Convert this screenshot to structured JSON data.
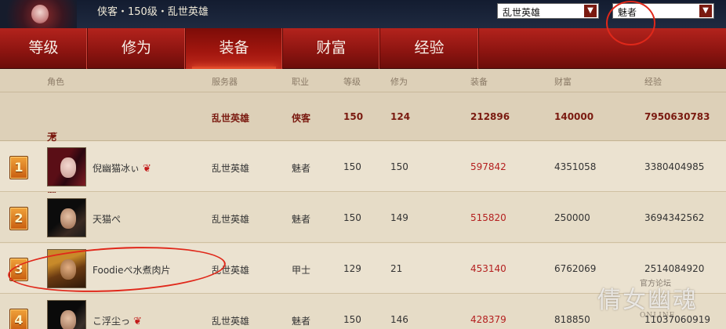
{
  "top_bar": {
    "character_info": "侠客・150级・乱世英雄",
    "server_select": "乱世英雄",
    "class_select": "魅者"
  },
  "tabs": [
    "等级",
    "修为",
    "装备",
    "财富",
    "经验"
  ],
  "active_tab": "装备",
  "columns": [
    "角色",
    "服务器",
    "职业",
    "等级",
    "修为",
    "装备",
    "财富",
    "经验"
  ],
  "my_row": {
    "name": "无敌最俊郎",
    "server": "乱世英雄",
    "class": "侠客",
    "level": "150",
    "cultivation": "124",
    "equipment": "212896",
    "wealth": "140000",
    "experience": "7950630783"
  },
  "rows": [
    {
      "rank": "1",
      "name": "倪幽猫冰ぃ",
      "server": "乱世英雄",
      "class": "魅者",
      "level": "150",
      "cultivation": "150",
      "equipment": "597842",
      "wealth": "4351058",
      "experience": "3380404985"
    },
    {
      "rank": "2",
      "name": "天猫ぺ",
      "server": "乱世英雄",
      "class": "魅者",
      "level": "150",
      "cultivation": "149",
      "equipment": "515820",
      "wealth": "250000",
      "experience": "3694342562"
    },
    {
      "rank": "3",
      "name": "Foodieぺ水煮肉片",
      "server": "乱世英雄",
      "class": "甲士",
      "level": "129",
      "cultivation": "21",
      "equipment": "453140",
      "wealth": "6762069",
      "experience": "2514084920"
    },
    {
      "rank": "4",
      "name": "こ浮尘っ",
      "server": "乱世英雄",
      "class": "魅者",
      "level": "150",
      "cultivation": "146",
      "equipment": "428379",
      "wealth": "818850",
      "experience": "11037060919"
    }
  ],
  "watermark": {
    "logo_text": "倩女幽魂",
    "official_text": "官方论坛",
    "online_text": "ONLINE"
  },
  "colors": {
    "tab_bg": "#8b1410",
    "highlight_text": "#7a1a10",
    "equipment_value": "#b41f1f",
    "annotation": "#e0281a"
  }
}
